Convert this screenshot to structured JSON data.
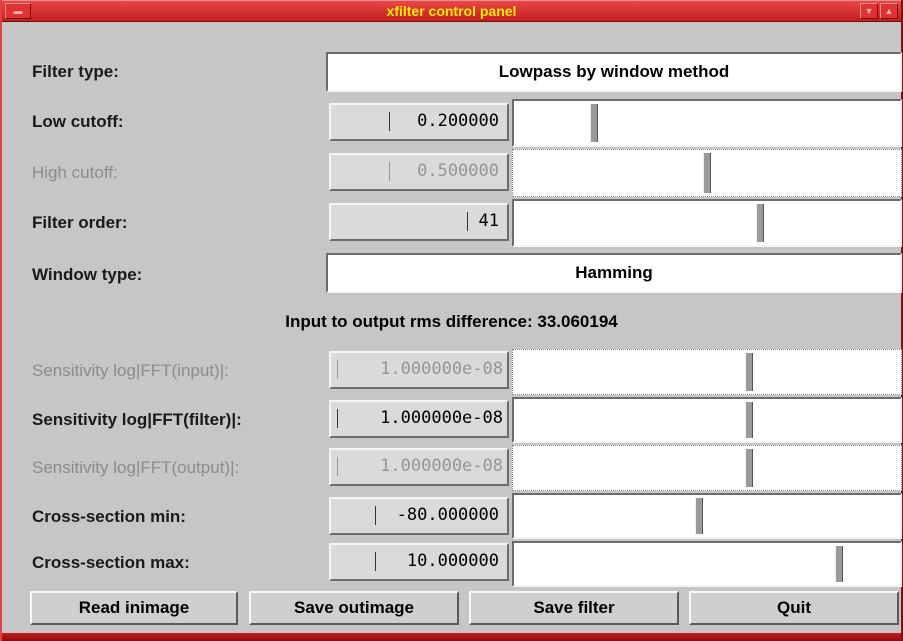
{
  "window": {
    "title": "xfilter control panel"
  },
  "filter_type": {
    "label": "Filter type:",
    "value": "Lowpass by window method"
  },
  "low_cutoff": {
    "label": "Low cutoff:",
    "value": "0.200000",
    "slider_level": 0.2
  },
  "high_cutoff": {
    "label": "High cutoff:",
    "value": "0.500000",
    "slider_level": 0.5,
    "enabled": false
  },
  "filter_order": {
    "label": "Filter order:",
    "value": "41",
    "slider_level": 0.64
  },
  "window_type": {
    "label": "Window type:",
    "value": "Hamming"
  },
  "rms_difference": "Input to output rms difference: 33.060194",
  "sens_input": {
    "label": "Sensitivity log|FFT(input)|:",
    "value": "1.000000e-08",
    "slider_level": 0.61,
    "enabled": false
  },
  "sens_filter": {
    "label": "Sensitivity log|FFT(filter)|:",
    "value": "1.000000e-08",
    "slider_level": 0.61
  },
  "sens_output": {
    "label": "Sensitivity log|FFT(output)|:",
    "value": "1.000000e-08",
    "slider_level": 0.61,
    "enabled": false
  },
  "cross_min": {
    "label": "Cross-section min:",
    "value": "-80.000000",
    "slider_level": 0.48
  },
  "cross_max": {
    "label": "Cross-section max:",
    "value": "10.000000",
    "slider_level": 0.85
  },
  "buttons": {
    "read_inimage": "Read inimage",
    "save_outimage": "Save outimage",
    "save_filter": "Save filter",
    "quit": "Quit"
  },
  "colors": {
    "titlebar": "#d32a2a",
    "title_text": "#ffee00",
    "panel": "#c6c6c6"
  }
}
